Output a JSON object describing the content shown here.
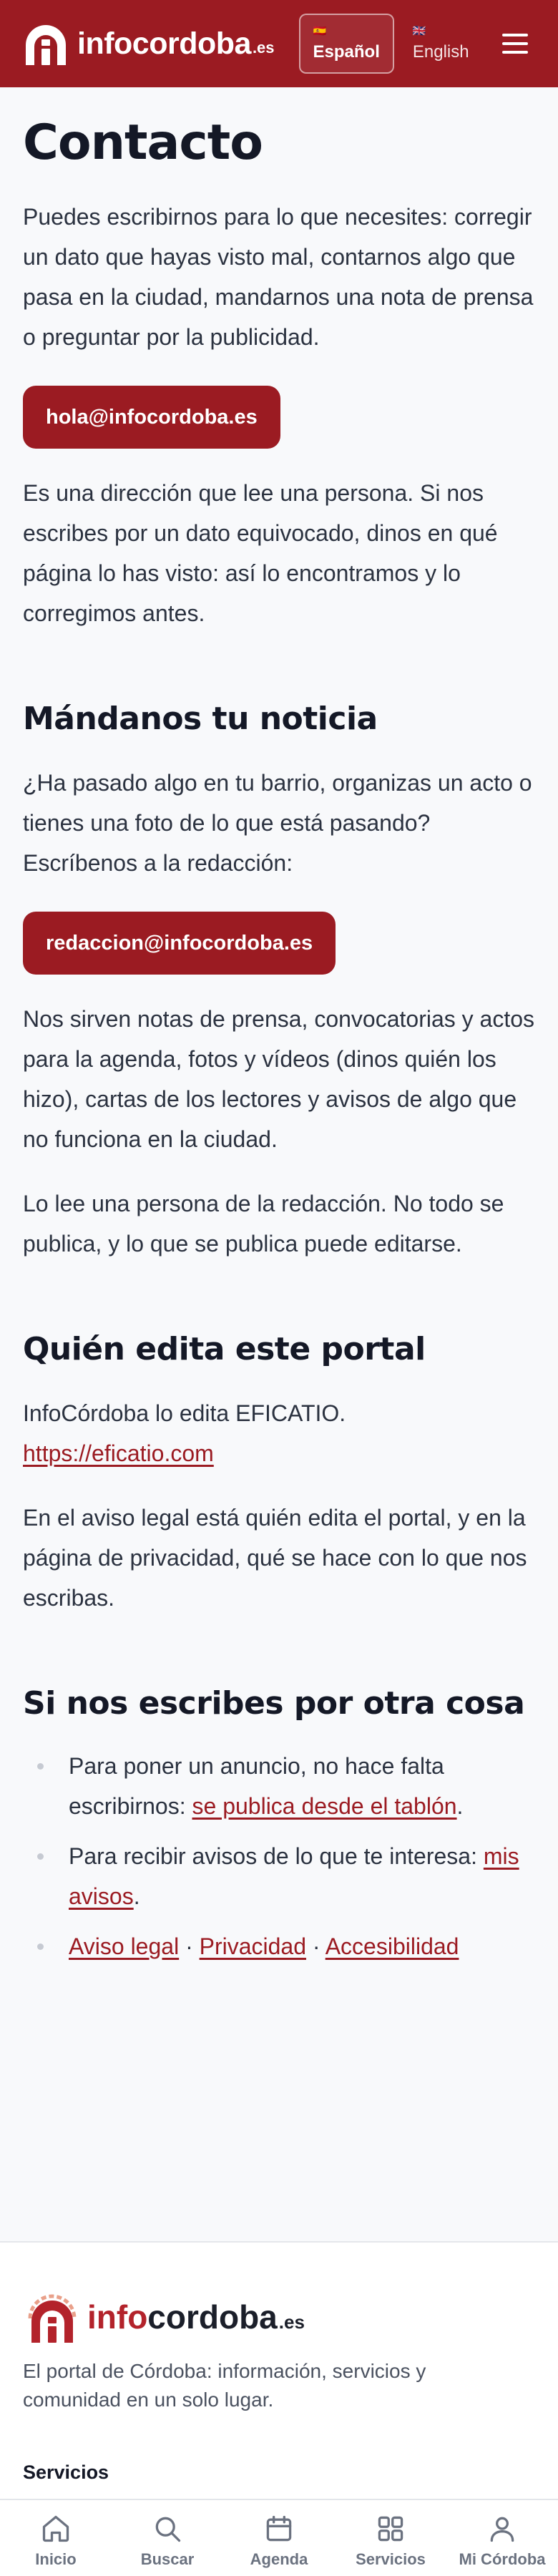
{
  "header": {
    "logo_text": "infocordoba",
    "logo_tld": ".es",
    "languages": [
      {
        "label": "Español",
        "flag": "🇪🇸",
        "active": true
      },
      {
        "label": "English",
        "flag": "🇬🇧",
        "active": false
      }
    ],
    "menu_icon": "hamburger-menu-icon"
  },
  "main": {
    "title": "Contacto",
    "intro": "Puedes escribirnos para lo que necesites: corregir un dato que hayas visto mal, contarnos algo que pasa en la ciudad, mandarnos una nota de prensa o preguntar por la publicidad.",
    "contact_email": "hola@infocordoba.es",
    "contact_note": "Es una dirección que lee una persona. Si nos escribes por un dato equivocado, dinos en qué página lo has visto: así lo encontramos y lo corregimos antes.",
    "news": {
      "heading": "Mándanos tu noticia",
      "text": "¿Ha pasado algo en tu barrio, organizas un acto o tienes una foto de lo que está pasando? Escríbenos a la redacción:",
      "email": "redaccion@infocordoba.es",
      "details": "Nos sirven notas de prensa, convocatorias y actos para la agenda, fotos y vídeos (dinos quién los hizo), cartas de los lectores y avisos de algo que no funciona en la ciudad.",
      "review": "Lo lee una persona de la redacción. No todo se publica, y lo que se publica puede editarse."
    },
    "editor": {
      "heading": "Quién edita este portal",
      "text": "InfoCórdoba lo edita EFICATIO.",
      "link": "https://eficatio.com",
      "legal": "En el aviso legal está quién edita el portal, y en la página de privacidad, qué se hace con lo que nos escribas."
    },
    "other": {
      "heading": "Si nos escribes por otra cosa",
      "ad_text": "Para poner un anuncio, no hace falta escribirnos: ",
      "ad_link": "se publica desde el tablón",
      "ad_end": ".",
      "alerts_text": "Para recibir avisos de lo que te interesa: ",
      "alerts_link": "mis avisos",
      "alerts_end": ".",
      "legal_links": [
        "Aviso legal",
        "Privacidad",
        "Accesibilidad"
      ],
      "separator": " · "
    }
  },
  "footer": {
    "logo_a": "info",
    "logo_b": "cordoba",
    "logo_c": ".es",
    "tagline": "El portal de Córdoba: información, servicios y comunidad en un solo lugar.",
    "section_heading": "Servicios"
  },
  "tabbar": [
    {
      "label": "Inicio",
      "icon": "home-icon"
    },
    {
      "label": "Buscar",
      "icon": "search-icon"
    },
    {
      "label": "Agenda",
      "icon": "calendar-icon"
    },
    {
      "label": "Servicios",
      "icon": "grid-icon"
    },
    {
      "label": "Mi Córdoba",
      "icon": "user-icon"
    }
  ],
  "colors": {
    "brand": "#9b1b22",
    "background": "#f8f9fb",
    "text": "#2b3240"
  }
}
